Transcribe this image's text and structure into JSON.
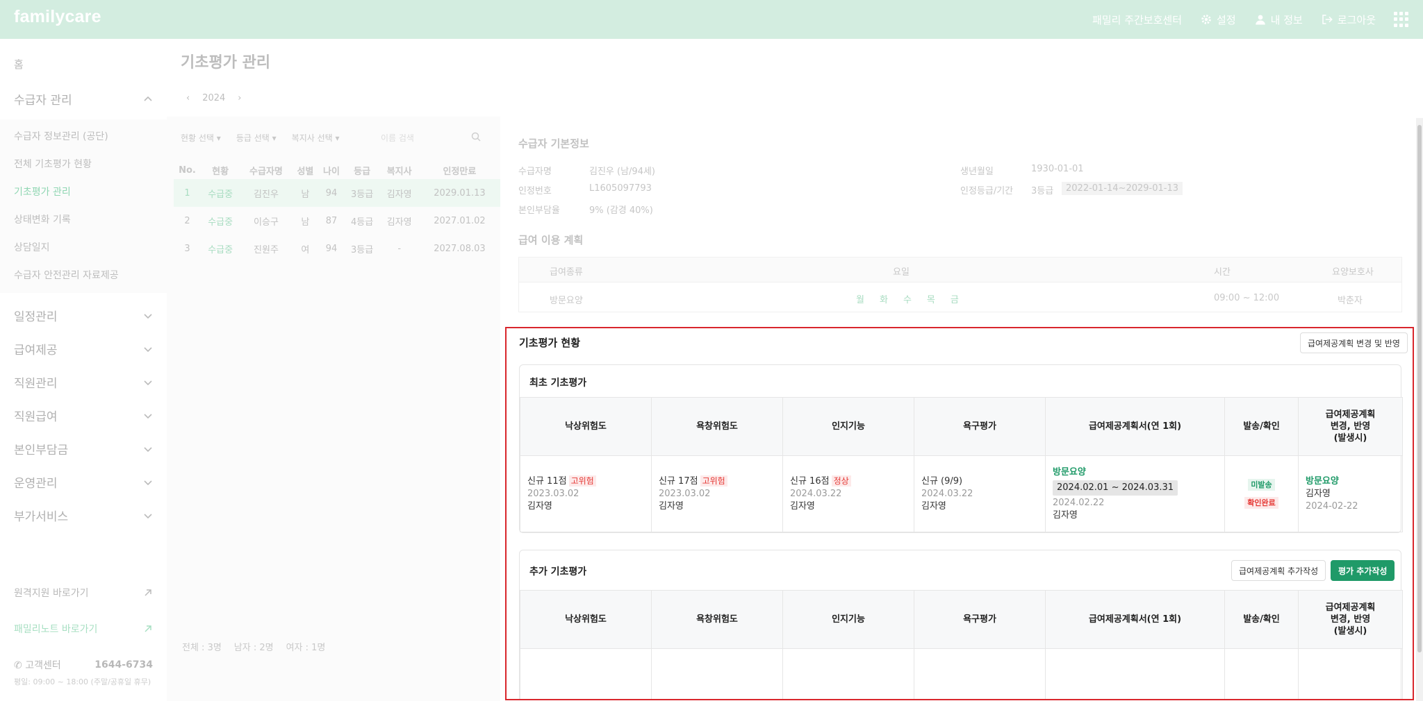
{
  "header": {
    "logo": "familycare",
    "center_name": "패밀리 주간보호센터",
    "settings": "설정",
    "my_info": "내 정보",
    "logout": "로그아웃"
  },
  "sidebar": {
    "home": "홈",
    "recipient_mgmt": "수급자 관리",
    "sub_items": [
      "수급자 정보관리 (공단)",
      "전체 기초평가 현황",
      "기초평가 관리",
      "상태변화 기록",
      "상담일지",
      "수급자 안전관리 자료제공"
    ],
    "sections": [
      "일정관리",
      "급여제공",
      "직원관리",
      "직원급여",
      "본인부담금",
      "운영관리",
      "부가서비스"
    ],
    "remote_support": "원격지원 바로가기",
    "family_note": "패밀리노트 바로가기",
    "support_center": "고객센터",
    "support_phone": "1644-6734",
    "support_hours": "평일: 09:00 ~ 18:00 (주말/공휴일 휴무)"
  },
  "page": {
    "title": "기초평가 관리",
    "year": "2024"
  },
  "filters": {
    "status": "현황 선택",
    "grade": "등급 선택",
    "worker": "복지사 선택",
    "search_placeholder": "이름 검색"
  },
  "list": {
    "columns": [
      "No.",
      "현황",
      "수급자명",
      "성별",
      "나이",
      "등급",
      "복지사",
      "인정만료"
    ],
    "rows": [
      [
        "1",
        "수급중",
        "김진우",
        "남",
        "94",
        "3등급",
        "김자영",
        "2029.01.13"
      ],
      [
        "2",
        "수급중",
        "이승구",
        "남",
        "87",
        "4등급",
        "김자영",
        "2027.01.02"
      ],
      [
        "3",
        "수급중",
        "진원주",
        "여",
        "94",
        "3등급",
        "-",
        "2027.08.03"
      ]
    ],
    "total": "전체 : 3명",
    "male": "남자 : 2명",
    "female": "여자 : 1명"
  },
  "basic_info": {
    "title": "수급자 기본정보",
    "name_label": "수급자명",
    "name_value": "김진우 (남/94세)",
    "id_label": "인정번호",
    "id_value": "L1605097793",
    "copay_label": "본인부담율",
    "copay_value": "9% (감경 40%)",
    "birth_label": "생년월일",
    "birth_value": "1930-01-01",
    "grade_label": "인정등급/기간",
    "grade_value": "3등급",
    "period_value": "2022-01-14~2029-01-13"
  },
  "benefit_plan": {
    "title": "급여 이용 계획",
    "columns": [
      "급여종류",
      "요일",
      "시간",
      "요양보호사"
    ],
    "type": "방문요양",
    "days": [
      "월",
      "화",
      "수",
      "목",
      "금"
    ],
    "time": "09:00 ~ 12:00",
    "caregiver": "박춘자"
  },
  "assessment": {
    "title": "기초평가 현황",
    "change_button": "급여제공계획 변경 및 반영",
    "columns": [
      "낙상위험도",
      "욕창위험도",
      "인지기능",
      "욕구평가",
      "급여제공계획서(연 1회)",
      "발송/확인",
      "급여제공계획\n변경, 반영\n(발생시)"
    ],
    "initial": {
      "title": "최초 기초평가",
      "fall": {
        "score": "신규 11점",
        "level": "고위험",
        "date": "2023.03.02",
        "by": "김자영"
      },
      "pressure": {
        "score": "신규 17점",
        "level": "고위험",
        "date": "2023.03.02",
        "by": "김자영"
      },
      "cognitive": {
        "score": "신규 16점",
        "level": "정상",
        "date": "2024.03.22",
        "by": "김자영"
      },
      "needs": {
        "score": "신규 (9/9)",
        "date": "2024.03.22",
        "by": "김자영"
      },
      "plan": {
        "type": "방문요양",
        "period": "2024.02.01 ~ 2024.03.31",
        "date": "2024.02.22",
        "by": "김자영"
      },
      "send": {
        "unsent": "미발송",
        "confirmed": "확인완료"
      },
      "change": {
        "type": "방문요양",
        "by": "김자영",
        "date": "2024-02-22"
      }
    },
    "additional": {
      "title": "추가 기초평가",
      "add_plan_button": "급여제공계획 추가작성",
      "add_eval_button": "평가 추가작성",
      "empty": "-"
    }
  }
}
